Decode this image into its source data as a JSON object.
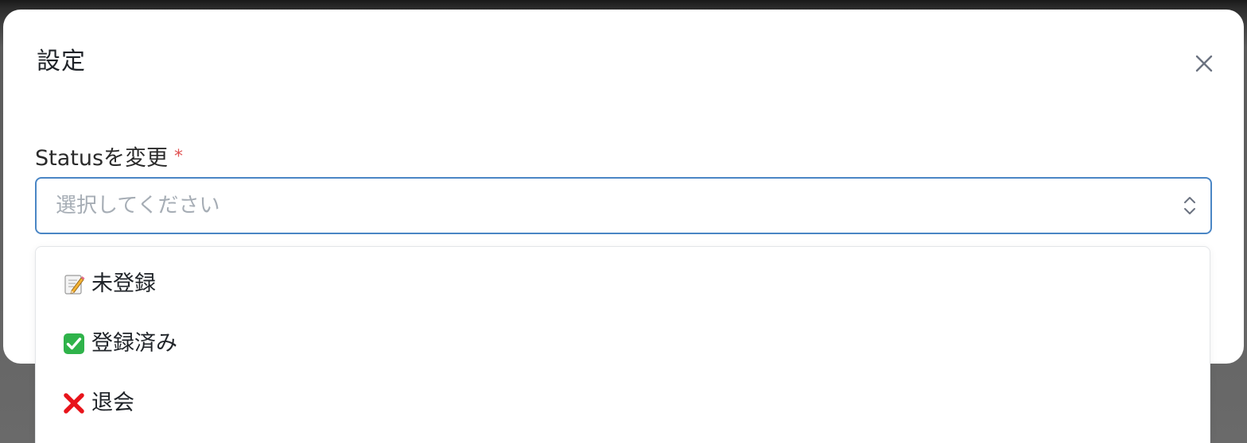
{
  "modal": {
    "title": "設定",
    "close_icon": "close-icon"
  },
  "field": {
    "label": "Statusを変更",
    "required_mark": "*",
    "placeholder": "選択してください",
    "chevron_icon": "chevron-up-down-icon"
  },
  "dropdown": {
    "options": [
      {
        "icon": "memo-pencil-icon",
        "label": "未登録"
      },
      {
        "icon": "check-mark-button-icon",
        "label": "登録済み"
      },
      {
        "icon": "cross-mark-icon",
        "label": "退会"
      }
    ]
  },
  "colors": {
    "focus_border": "#4a86c5",
    "required": "#e05252",
    "placeholder": "#a6adb5",
    "check_green": "#2fb34a",
    "cross_red": "#e8141b"
  }
}
